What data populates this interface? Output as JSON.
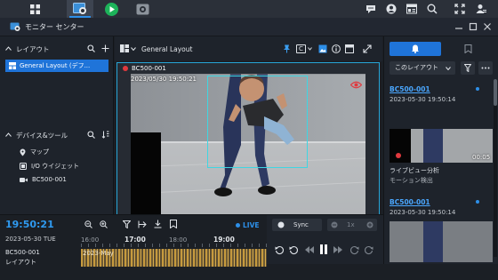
{
  "window": {
    "title": "モニター センター"
  },
  "sidebar": {
    "layout_section": "レイアウト",
    "layout_item": "General Layout (デフ...",
    "devices_section": "デバイス&ツール",
    "devices": [
      {
        "label": "マップ",
        "icon": "map-pin-icon"
      },
      {
        "label": "I/O ウイジェット",
        "icon": "io-widget-icon"
      },
      {
        "label": "BC500-001",
        "icon": "camera-icon"
      }
    ]
  },
  "toolbar": {
    "layout_name": "General Layout",
    "stream_badge": "C"
  },
  "tile": {
    "camera_name": "BC500-001",
    "timestamp": "2023/05/30 19:50:21"
  },
  "right_panel": {
    "filter_label": "このレイアウト",
    "events": [
      {
        "camera": "BC500-001",
        "time": "2023-05-30 19:50:14",
        "duration": "00:05",
        "title": "ライブビュー分析",
        "subtitle": "モーション検出"
      },
      {
        "camera": "BC500-001",
        "time": "2023-05-30 19:50:14"
      }
    ]
  },
  "timeline": {
    "current_time": "19:50:21",
    "date": "2023-05-30 TUE",
    "live_label": "LIVE",
    "ticks": [
      "16:00",
      "17:00",
      "18:00",
      "19:00"
    ],
    "track_label": "2023-May",
    "row_camera": "BC500-001",
    "row_layout": "レイアウト"
  },
  "playback": {
    "sync_label": "Sync",
    "speed": "1x"
  },
  "colors": {
    "accent": "#1f74d9",
    "live": "#2d8fe8",
    "highlight": "#27a6d8",
    "record": "#e0393e"
  }
}
